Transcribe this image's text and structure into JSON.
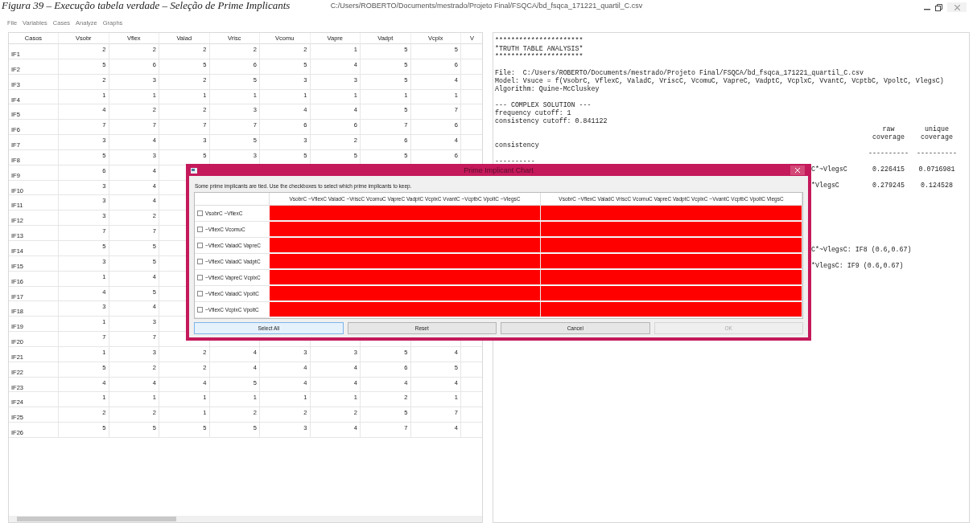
{
  "caption": "Figura 39 – Execução tabela verdade – Seleção de *Prime Implicants*",
  "window": {
    "title": "C:/Users/ROBERTO/Documents/mestrado/Projeto Final/FSQCA/bd_fsqca_171221_quartil_C.csv"
  },
  "menu": [
    "File",
    "Variables",
    "Cases",
    "Analyze",
    "Graphs"
  ],
  "table": {
    "columns": [
      "Casos",
      "Vsobr",
      "Vflex",
      "Valad",
      "Vrisc",
      "Vcomu",
      "Vapre",
      "Vadpt",
      "Vcplx",
      "V"
    ],
    "rows": [
      {
        "case": "IF1",
        "values": [
          "2",
          "2",
          "2",
          "2",
          "2",
          "1",
          "5",
          "5"
        ]
      },
      {
        "case": "IF2",
        "values": [
          "5",
          "6",
          "5",
          "6",
          "5",
          "4",
          "5",
          "6"
        ]
      },
      {
        "case": "IF3",
        "values": [
          "2",
          "3",
          "2",
          "5",
          "3",
          "3",
          "5",
          "4"
        ]
      },
      {
        "case": "IF4",
        "values": [
          "1",
          "1",
          "1",
          "1",
          "1",
          "1",
          "1",
          "1"
        ]
      },
      {
        "case": "IF5",
        "values": [
          "4",
          "2",
          "2",
          "3",
          "4",
          "4",
          "5",
          "7"
        ]
      },
      {
        "case": "IF6",
        "values": [
          "7",
          "7",
          "7",
          "7",
          "6",
          "6",
          "7",
          "6"
        ]
      },
      {
        "case": "IF7",
        "values": [
          "3",
          "4",
          "3",
          "5",
          "3",
          "2",
          "6",
          "4"
        ]
      },
      {
        "case": "IF8",
        "values": [
          "5",
          "3",
          "5",
          "3",
          "5",
          "5",
          "5",
          "6"
        ]
      },
      {
        "case": "IF9",
        "values": [
          "6",
          "4"
        ]
      },
      {
        "case": "IF10",
        "values": [
          "3",
          "4"
        ]
      },
      {
        "case": "IF11",
        "values": [
          "3",
          "4"
        ]
      },
      {
        "case": "IF12",
        "values": [
          "3",
          "2"
        ]
      },
      {
        "case": "IF13",
        "values": [
          "7",
          "7"
        ]
      },
      {
        "case": "IF14",
        "values": [
          "5",
          "5"
        ]
      },
      {
        "case": "IF15",
        "values": [
          "3",
          "5"
        ]
      },
      {
        "case": "IF16",
        "values": [
          "1",
          "4"
        ]
      },
      {
        "case": "IF17",
        "values": [
          "4",
          "5"
        ]
      },
      {
        "case": "IF18",
        "values": [
          "3",
          "4"
        ]
      },
      {
        "case": "IF19",
        "values": [
          "1",
          "3"
        ]
      },
      {
        "case": "IF20",
        "values": [
          "7",
          "7"
        ]
      },
      {
        "case": "IF21",
        "values": [
          "1",
          "3",
          "2",
          "4",
          "3",
          "3",
          "5",
          "4"
        ]
      },
      {
        "case": "IF22",
        "values": [
          "5",
          "2",
          "2",
          "4",
          "4",
          "4",
          "6",
          "5"
        ]
      },
      {
        "case": "IF23",
        "values": [
          "4",
          "4",
          "4",
          "5",
          "4",
          "4",
          "4",
          "4"
        ]
      },
      {
        "case": "IF24",
        "values": [
          "1",
          "1",
          "1",
          "1",
          "1",
          "1",
          "2",
          "1"
        ]
      },
      {
        "case": "IF25",
        "values": [
          "2",
          "2",
          "1",
          "2",
          "2",
          "2",
          "5",
          "7"
        ]
      },
      {
        "case": "IF26",
        "values": [
          "5",
          "5",
          "5",
          "5",
          "3",
          "4",
          "7",
          "4"
        ]
      }
    ]
  },
  "output": {
    "lines": [
      {
        "kind": "text",
        "text": "**********************"
      },
      {
        "kind": "text",
        "text": "*TRUTH TABLE ANALYSIS*"
      },
      {
        "kind": "text",
        "text": "**********************"
      },
      {
        "kind": "blank"
      },
      {
        "kind": "text",
        "text": "File:  C:/Users/ROBERTO/Documents/mestrado/Projeto Final/FSQCA/bd_fsqca_171221_quartil_C.csv"
      },
      {
        "kind": "text",
        "text": "Model: Vsuce = f(VsobrC, VflexC, ValadC, VriscC, VcomuC, VapreC, VadptC, VcplxC, VvantC, VcptbC, VpoltC, VlegsC)"
      },
      {
        "kind": "text",
        "text": "Algorithm: Quine-McCluskey"
      },
      {
        "kind": "blank"
      },
      {
        "kind": "text",
        "text": "--- COMPLEX SOLUTION ---"
      },
      {
        "kind": "text",
        "text": "frequency cutoff: 1"
      },
      {
        "kind": "text",
        "text": "consistency cutoff: 0.841122"
      },
      {
        "kind": "columns",
        "raw": "raw",
        "unique": "unique"
      },
      {
        "kind": "columns",
        "raw": "coverage",
        "unique": "coverage"
      },
      {
        "kind": "text",
        "text": "consistency"
      },
      {
        "kind": "columns",
        "raw": "----------",
        "unique": "----------"
      },
      {
        "kind": "text",
        "text": "----------"
      },
      {
        "kind": "columns",
        "label": "C*~VlegsC",
        "raw": "0.226415",
        "unique": "0.0716981"
      },
      {
        "kind": "blank"
      },
      {
        "kind": "columns",
        "label": "*VlegsC",
        "raw": "0.279245",
        "unique": "0.124528"
      },
      {
        "kind": "blank"
      },
      {
        "kind": "blank"
      },
      {
        "kind": "blank"
      },
      {
        "kind": "blank"
      },
      {
        "kind": "blank"
      },
      {
        "kind": "blank"
      },
      {
        "kind": "blank"
      },
      {
        "kind": "columns",
        "label": "C*~VlegsC: IF8 (0.6,0.67)"
      },
      {
        "kind": "blank"
      },
      {
        "kind": "columns",
        "label": "*VlegsC: IF9 (0.6,0.67)"
      }
    ]
  },
  "dialog": {
    "title": "Prime Implicant Chart",
    "message": "Some prime implicants are tied. Use the checkboxes to select which prime implicants to keep.",
    "columns": [
      "VsobrC ~VflexC ValadC ~VriscC VcomuC VapreC VadptC VcplxC VvantC ~VcptbC VpoltC ~VlegsC",
      "VsobrC ~VflexC ValadC VriscC VcomuC VapreC VadptC VcplxC ~VvantC VcptbC VpoltC VlegsC"
    ],
    "rows": [
      {
        "label": "VsobrC ~VflexC",
        "checked": false,
        "cells": [
          {
            "covered": true
          },
          {
            "covered": true
          }
        ]
      },
      {
        "label": "~VflexC VcomuC",
        "checked": false,
        "cells": [
          {
            "covered": true
          },
          {
            "covered": true
          }
        ]
      },
      {
        "label": "~VflexC ValadC VapreC",
        "checked": false,
        "cells": [
          {
            "covered": true
          },
          {
            "covered": true
          }
        ]
      },
      {
        "label": "~VflexC ValadC VadptC",
        "checked": false,
        "cells": [
          {
            "covered": true
          },
          {
            "covered": true
          }
        ]
      },
      {
        "label": "~VflexC VapreC VcplxC",
        "checked": false,
        "cells": [
          {
            "covered": true
          },
          {
            "covered": true
          }
        ]
      },
      {
        "label": "~VflexC ValadC VpoltC",
        "checked": false,
        "cells": [
          {
            "covered": true
          },
          {
            "covered": true
          }
        ]
      },
      {
        "label": "~VflexC VcplxC VpoltC",
        "checked": false,
        "cells": [
          {
            "covered": true
          },
          {
            "covered": true
          }
        ]
      }
    ],
    "buttons": [
      {
        "label": "Select All",
        "focused": true,
        "disabled": false
      },
      {
        "label": "Reset",
        "focused": false,
        "disabled": false
      },
      {
        "label": "Cancel",
        "focused": false,
        "disabled": false
      },
      {
        "label": "OK",
        "focused": false,
        "disabled": true
      }
    ]
  }
}
